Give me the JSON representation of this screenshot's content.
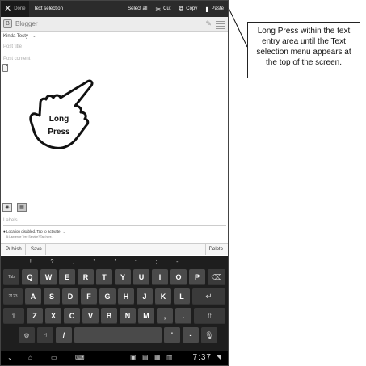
{
  "action_bar": {
    "done_label": "Done",
    "title": "Text selection",
    "actions": [
      {
        "label": "Select all",
        "icon": "select-all-icon"
      },
      {
        "label": "Cut",
        "icon": "scissors-icon"
      },
      {
        "label": "Copy",
        "icon": "copy-icon"
      },
      {
        "label": "Paste",
        "icon": "clipboard-icon"
      }
    ]
  },
  "app": {
    "name": "Blogger",
    "account": "Kinda Testy",
    "post_title_placeholder": "Post title",
    "post_content_placeholder": "Post content",
    "labels_placeholder": "Labels",
    "location_status": "Location disabled. Tap to activate",
    "location_hint": "At Lawrence Tree Service? Tap here.",
    "buttons": {
      "publish": "Publish",
      "save": "Save",
      "delete": "Delete"
    }
  },
  "gesture": {
    "line1": "Long",
    "line2": "Press"
  },
  "keyboard": {
    "suggestions": [
      "!",
      "?",
      ",",
      "\"",
      "'",
      ":",
      ";",
      "-",
      "."
    ],
    "row1": [
      "Q",
      "W",
      "E",
      "R",
      "T",
      "Y",
      "U",
      "I",
      "O",
      "P"
    ],
    "row2": [
      "A",
      "S",
      "D",
      "F",
      "G",
      "H",
      "J",
      "K",
      "L"
    ],
    "row3": [
      "Z",
      "X",
      "C",
      "V",
      "B",
      "N",
      "M"
    ],
    "tab_label": "Tab",
    "symbols_label": "?123",
    "slash": "/",
    "apostrophe": "'",
    "dash": "-",
    "symbol_key": ":-)"
  },
  "status": {
    "time": "7:37"
  },
  "callout": {
    "text": "Long Press within the text entry area until the Text selection menu appears at the top of the screen."
  }
}
